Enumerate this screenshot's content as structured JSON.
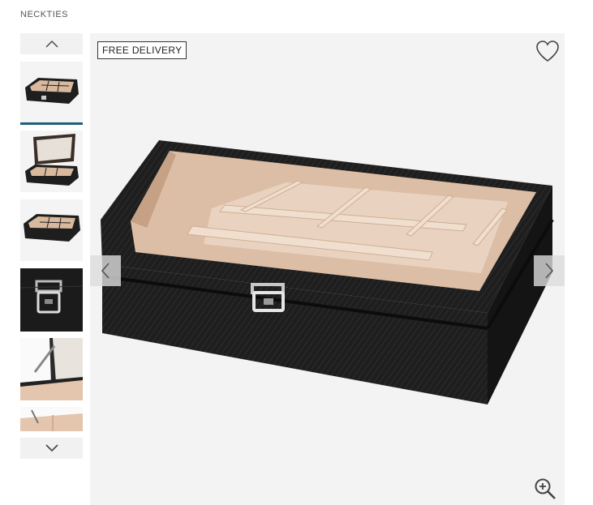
{
  "breadcrumb": "NECKTIES",
  "badge": "FREE DELIVERY",
  "thumbnails": [
    {
      "icon": "box-closed-thumbnail",
      "active": true
    },
    {
      "icon": "box-open-lid-thumbnail",
      "active": false
    },
    {
      "icon": "box-angle-thumbnail",
      "active": false
    },
    {
      "icon": "clasp-closeup-thumbnail",
      "active": false
    },
    {
      "icon": "hinge-closeup-thumbnail",
      "active": false
    },
    {
      "icon": "interior-closeup-thumbnail",
      "active": false
    }
  ],
  "icons": {
    "thumb_up": "chevron-up-icon",
    "thumb_down": "chevron-down-icon",
    "favorite": "heart-icon",
    "prev": "chevron-left-icon",
    "next": "chevron-right-icon",
    "zoom": "zoom-in-icon"
  },
  "colors": {
    "accent": "#1f5f7a",
    "box_leather": "#1e1e1e",
    "box_interior": "#e8d3c0"
  }
}
